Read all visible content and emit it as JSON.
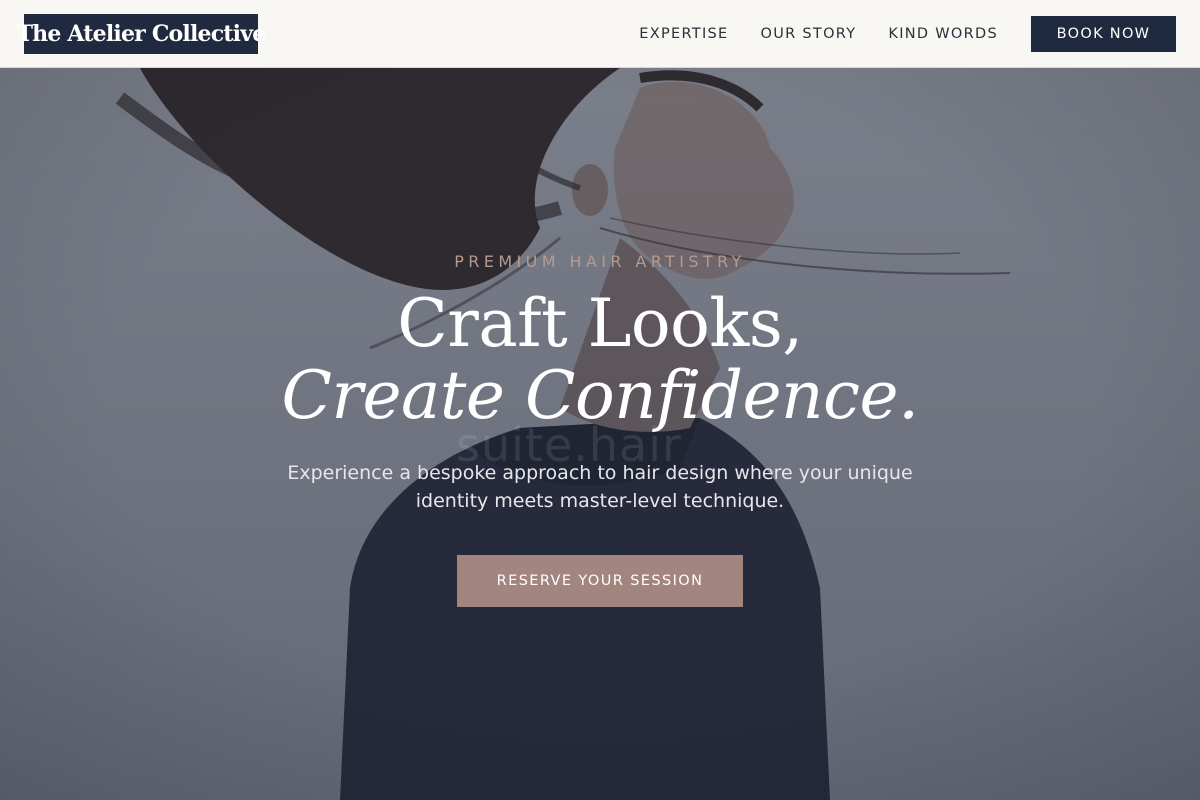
{
  "header": {
    "logo_text": "The Atelier Collective",
    "nav": [
      {
        "label": "EXPERTISE"
      },
      {
        "label": "OUR STORY"
      },
      {
        "label": "KIND WORDS"
      }
    ],
    "book_label": "BOOK NOW"
  },
  "hero": {
    "eyebrow": "PREMIUM HAIR ARTISTRY",
    "headline_line1": "Craft Looks,",
    "headline_line2": "Create Confidence.",
    "subtext": "Experience a bespoke approach to hair design where your unique identity meets master-level technique.",
    "cta_label": "RESERVE YOUR SESSION",
    "watermark": "suite.hair"
  },
  "colors": {
    "navy": "#1f2a40",
    "accent_rose": "#a1857e",
    "eyebrow": "#b59a90",
    "header_bg": "#f8f7f3"
  }
}
